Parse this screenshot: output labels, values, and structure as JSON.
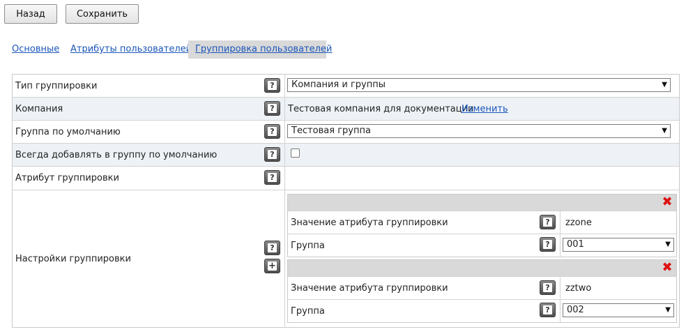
{
  "toolbar": {
    "back_label": "Назад",
    "save_label": "Сохранить"
  },
  "tabs": [
    {
      "label": "Основные",
      "active": false
    },
    {
      "label": "Атрибуты пользователей",
      "active": false
    },
    {
      "label": "Группировка пользователей",
      "active": true
    }
  ],
  "form": {
    "grouping_type": {
      "label": "Тип группировки",
      "value": "Компания и группы"
    },
    "company": {
      "label": "Компания",
      "value": "Тестовая компания для документации",
      "change_link": "Изменить"
    },
    "default_group": {
      "label": "Группа по умолчанию",
      "value": "Тестовая группа"
    },
    "always_add": {
      "label": "Всегда добавлять в группу по умолчанию",
      "checked": false
    },
    "grouping_attribute": {
      "label": "Атрибут группировки",
      "value": ""
    },
    "grouping_settings": {
      "label": "Настройки группировки",
      "entries": [
        {
          "attr_label": "Значение атрибута группировки",
          "attr_value": "zzone",
          "group_label": "Группа",
          "group_value": "001"
        },
        {
          "attr_label": "Значение атрибута группировки",
          "attr_value": "zztwo",
          "group_label": "Группа",
          "group_value": "002"
        }
      ]
    }
  },
  "icons": {
    "help": "help-icon",
    "add": "add-icon",
    "delete": "delete-icon",
    "dropdown": "chevron-down-icon"
  },
  "colors": {
    "link": "#1a55b8",
    "delete": "#dd1111",
    "active_tab_bg": "#d9d9d9",
    "alt_row_bg": "#eef2f6"
  }
}
